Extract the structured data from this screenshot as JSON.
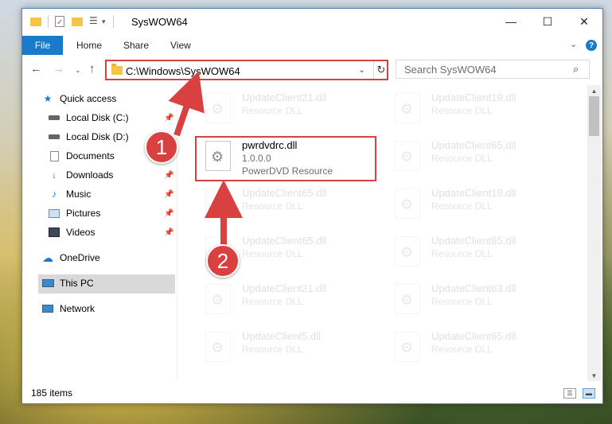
{
  "window": {
    "title": "SysWOW64",
    "controls": {
      "minimize": "—",
      "maximize": "☐",
      "close": "✕"
    }
  },
  "ribbon": {
    "tabs": [
      "File",
      "Home",
      "Share",
      "View"
    ],
    "help": "?"
  },
  "address": {
    "path": "C:\\Windows\\SysWOW64",
    "dropdown": "⌄",
    "refresh": "↻"
  },
  "search": {
    "placeholder": "Search SysWOW64",
    "icon": "search-icon"
  },
  "nav": {
    "items": [
      {
        "label": "Quick access",
        "icon": "star-icon"
      },
      {
        "label": "Local Disk (C:)",
        "icon": "drive-icon"
      },
      {
        "label": "Local Disk (D:)",
        "icon": "drive-icon"
      },
      {
        "label": "Documents",
        "icon": "documents-icon"
      },
      {
        "label": "Downloads",
        "icon": "download-icon"
      },
      {
        "label": "Music",
        "icon": "music-icon"
      },
      {
        "label": "Pictures",
        "icon": "pictures-icon"
      },
      {
        "label": "Videos",
        "icon": "videos-icon"
      },
      {
        "label": "OneDrive",
        "icon": "cloud-icon"
      },
      {
        "label": "This PC",
        "icon": "computer-icon"
      },
      {
        "label": "Network",
        "icon": "network-icon"
      }
    ]
  },
  "files": {
    "highlighted": {
      "name": "pwrdvdrc.dll",
      "version": "1.0.0.0",
      "description": "PowerDVD Resource"
    },
    "background": [
      {
        "name": "UpdateClient21.dll",
        "type": "Resource DLL"
      },
      {
        "name": "UpdateClient19.dll",
        "type": "Resource DLL"
      },
      {
        "name": "UpdateClient65.dll",
        "type": "Resource DLL"
      },
      {
        "name": "UpdateClient65.dll",
        "type": "Resource DLL"
      },
      {
        "name": "UpdateClient19.dll",
        "type": "Resource DLL"
      },
      {
        "name": "UpdateClient65.dll",
        "type": "Resource DLL"
      },
      {
        "name": "UpdateClient65.dll",
        "type": "Resource DLL"
      },
      {
        "name": "UpdateClient21.dll",
        "type": "Resource DLL"
      },
      {
        "name": "UpdateClient63.dll",
        "type": "Resource DLL"
      },
      {
        "name": "UpdateClient5.dll",
        "type": "Resource DLL"
      },
      {
        "name": "UpdateClient65.dll",
        "type": "Resource DLL"
      }
    ]
  },
  "status": {
    "item_count": "185 items"
  },
  "annotations": {
    "step1": "1",
    "step2": "2",
    "color": "#d94040"
  }
}
